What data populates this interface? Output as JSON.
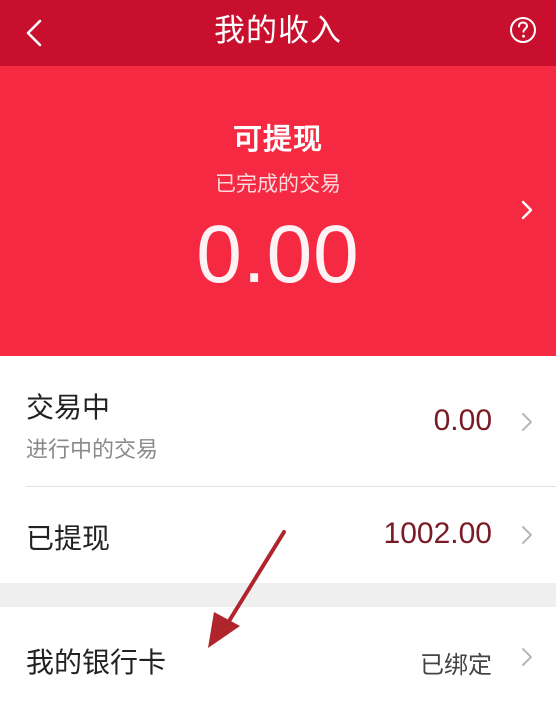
{
  "header": {
    "title": "我的收入",
    "back_icon": "chevron-left-icon",
    "help_icon": "question-circle-icon"
  },
  "available": {
    "label": "可提现",
    "subtitle": "已完成的交易",
    "amount": "0.00"
  },
  "rows": {
    "trading": {
      "label": "交易中",
      "subtitle": "进行中的交易",
      "value": "0.00"
    },
    "withdrawn": {
      "label": "已提现",
      "value": "1002.00"
    },
    "bank_card": {
      "label": "我的银行卡",
      "value": "已绑定"
    }
  },
  "colors": {
    "header_bg": "#c8102e",
    "hero_bg": "#f52a42",
    "value_text": "#7a1a26",
    "annotation_arrow": "#b0242c"
  }
}
